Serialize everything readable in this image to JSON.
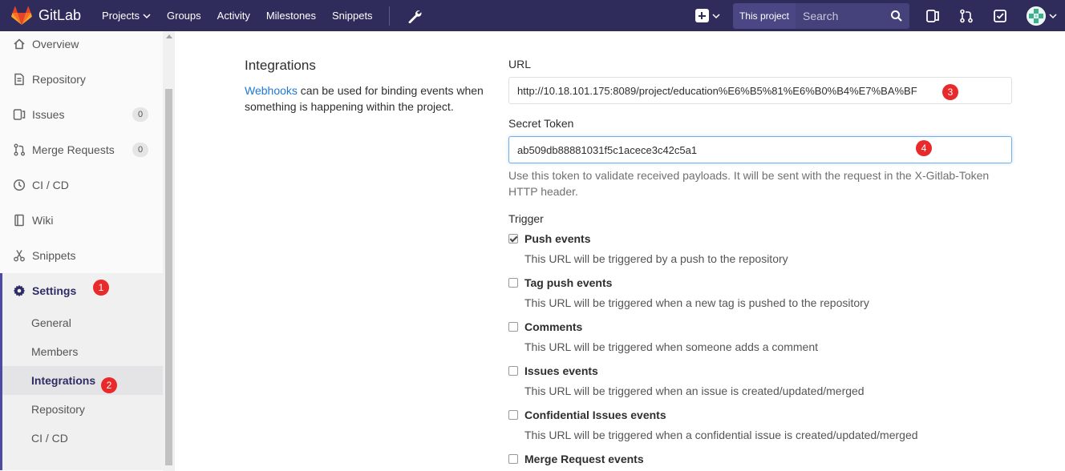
{
  "navbar": {
    "brand": "GitLab",
    "links": [
      "Projects",
      "Groups",
      "Activity",
      "Milestones",
      "Snippets"
    ],
    "scope_label": "This project",
    "search_placeholder": "Search"
  },
  "sidebar": {
    "items": [
      {
        "label": "Overview",
        "icon": "home-icon"
      },
      {
        "label": "Repository",
        "icon": "doc-icon"
      },
      {
        "label": "Issues",
        "icon": "issues-icon",
        "badge": "0"
      },
      {
        "label": "Merge Requests",
        "icon": "merge-icon",
        "badge": "0"
      },
      {
        "label": "CI / CD",
        "icon": "rocket-icon"
      },
      {
        "label": "Wiki",
        "icon": "book-icon"
      },
      {
        "label": "Snippets",
        "icon": "scissors-icon"
      }
    ],
    "settings": {
      "label": "Settings",
      "subitems": [
        "General",
        "Members",
        "Integrations",
        "Repository",
        "CI / CD"
      ],
      "active": "Integrations"
    }
  },
  "markers": [
    "1",
    "2",
    "3",
    "4"
  ],
  "main": {
    "title": "Integrations",
    "desc_link": "Webhooks",
    "desc_text": " can be used for binding events when something is happening within the project.",
    "url_label": "URL",
    "url_value": "http://10.18.101.175:8089/project/education%E6%B5%81%E6%B0%B4%E7%BA%BF",
    "token_label": "Secret Token",
    "token_value": "ab509db88881031f5c1acece3c42c5a1",
    "token_help": "Use this token to validate received payloads. It will be sent with the request in the X-Gitlab-Token HTTP header.",
    "trigger_label": "Trigger",
    "triggers": [
      {
        "label": "Push events",
        "help": "This URL will be triggered by a push to the repository",
        "checked": true
      },
      {
        "label": "Tag push events",
        "help": "This URL will be triggered when a new tag is pushed to the repository",
        "checked": false
      },
      {
        "label": "Comments",
        "help": "This URL will be triggered when someone adds a comment",
        "checked": false
      },
      {
        "label": "Issues events",
        "help": "This URL will be triggered when an issue is created/updated/merged",
        "checked": false
      },
      {
        "label": "Confidential Issues events",
        "help": "This URL will be triggered when a confidential issue is created/updated/merged",
        "checked": false
      },
      {
        "label": "Merge Request events",
        "help": "",
        "checked": false
      }
    ]
  },
  "colors": {
    "navbar": "#2f2b5a",
    "link": "#1f78d1",
    "marker": "#e82a2a",
    "settings_accent": "#4b4ba3"
  }
}
